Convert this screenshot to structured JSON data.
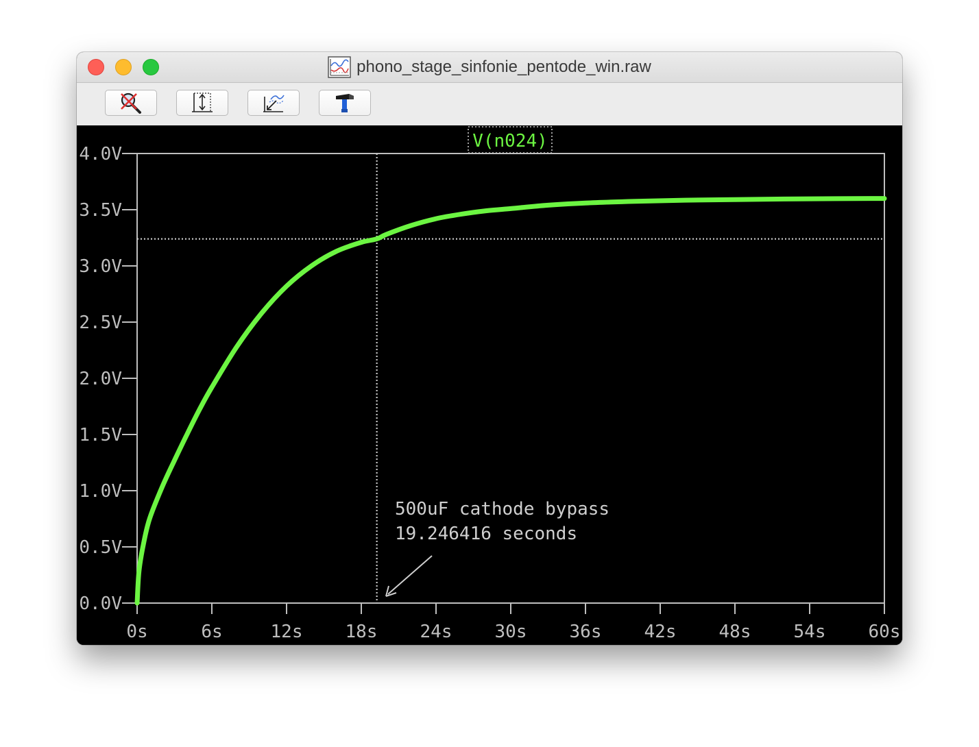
{
  "window": {
    "title": "phono_stage_sinfonie_pentode_win.raw"
  },
  "toolbar": {
    "buttons": [
      {
        "name": "zoom-cancel-button",
        "icon": "zoom-cancel-icon"
      },
      {
        "name": "autorange-button",
        "icon": "autorange-icon"
      },
      {
        "name": "zoom-back-button",
        "icon": "zoom-back-icon"
      },
      {
        "name": "tools-button",
        "icon": "hammer-icon"
      }
    ]
  },
  "colors": {
    "trace": "#6cf542",
    "axis": "#bfbfbf",
    "background": "#000000",
    "cursor": "#c8c8c8"
  },
  "chart_data": {
    "type": "line",
    "title": "",
    "trace_label": "V(n024)",
    "xlabel": "",
    "ylabel": "",
    "xlim": [
      0,
      60
    ],
    "ylim": [
      0,
      4
    ],
    "x_ticks": [
      "0s",
      "6s",
      "12s",
      "18s",
      "24s",
      "30s",
      "36s",
      "42s",
      "48s",
      "54s",
      "60s"
    ],
    "y_ticks": [
      "0.0V",
      "0.5V",
      "1.0V",
      "1.5V",
      "2.0V",
      "2.5V",
      "3.0V",
      "3.5V",
      "4.0V"
    ],
    "series": [
      {
        "name": "V(n024)",
        "x": [
          0,
          0.15,
          0.5,
          1,
          2,
          3,
          4,
          5,
          6,
          8,
          10,
          12,
          14,
          16,
          18,
          19.25,
          20,
          22,
          24,
          26,
          28,
          30,
          33,
          36,
          40,
          44,
          48,
          52,
          56,
          60
        ],
        "y": [
          0,
          0.28,
          0.52,
          0.75,
          1.03,
          1.27,
          1.5,
          1.72,
          1.92,
          2.28,
          2.58,
          2.82,
          3.0,
          3.13,
          3.21,
          3.24,
          3.28,
          3.36,
          3.42,
          3.46,
          3.49,
          3.51,
          3.54,
          3.56,
          3.575,
          3.585,
          3.59,
          3.595,
          3.598,
          3.6
        ]
      }
    ],
    "cursor": {
      "x": 19.246416,
      "y": 3.24
    },
    "annotation": {
      "line1": "500uF cathode bypass",
      "line2": "19.246416 seconds"
    },
    "grid": false
  }
}
